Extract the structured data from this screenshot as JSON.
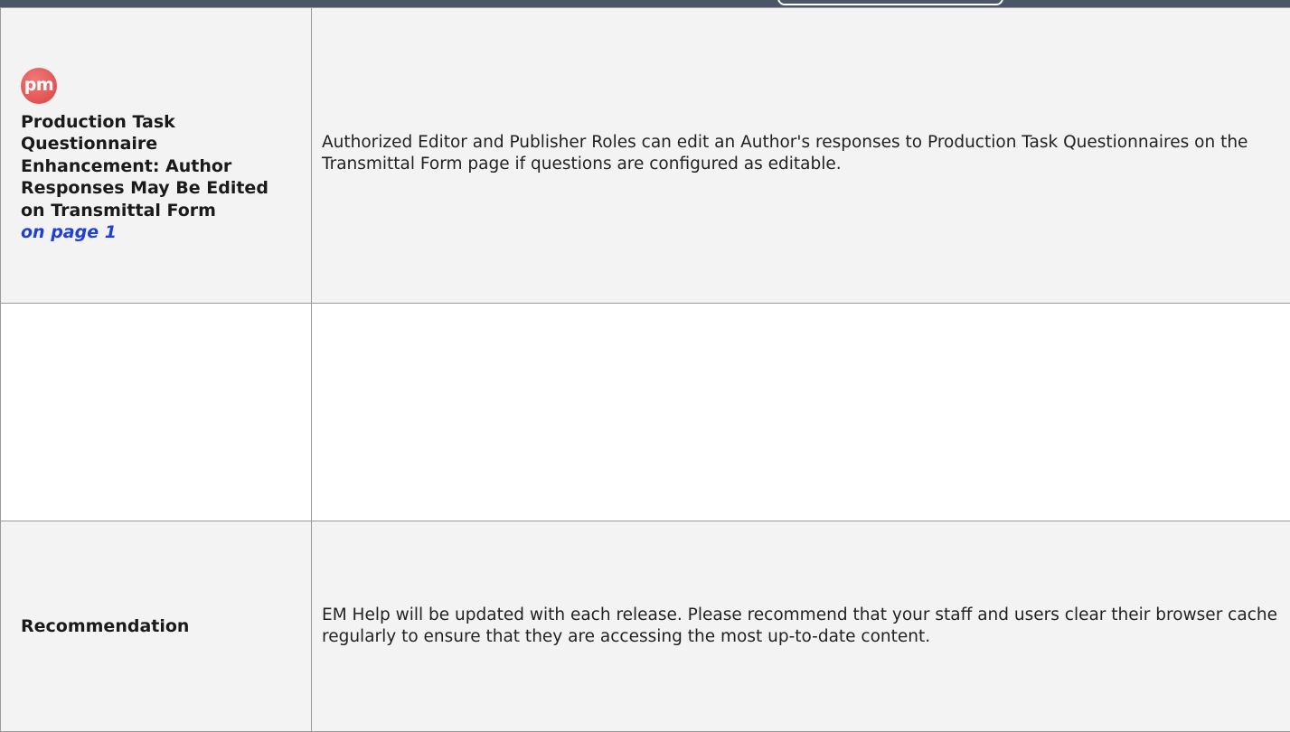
{
  "table": {
    "row1": {
      "badge_text": "pm",
      "title": "Production Task Questionnaire Enhancement: Author Responses May Be Edited on Transmittal Form",
      "link_text": "on page 1",
      "description": "Authorized Editor and Publisher Roles can edit an Author's responses to Production Task Questionnaires on the Transmittal Form page if questions are configured as editable."
    },
    "row2": {
      "left": "",
      "right": ""
    },
    "row3": {
      "label": "Recommendation",
      "description": "EM Help will be updated with each release. Please recommend that your staff and users clear their browser cache regularly to ensure that they are accessing the most up-to-date content."
    }
  },
  "colors": {
    "header_bar": "#4a5568",
    "badge": "#e25252",
    "link": "#1f3fd6",
    "cell_background": "#f3f3f3",
    "border": "#9a9a9a"
  }
}
